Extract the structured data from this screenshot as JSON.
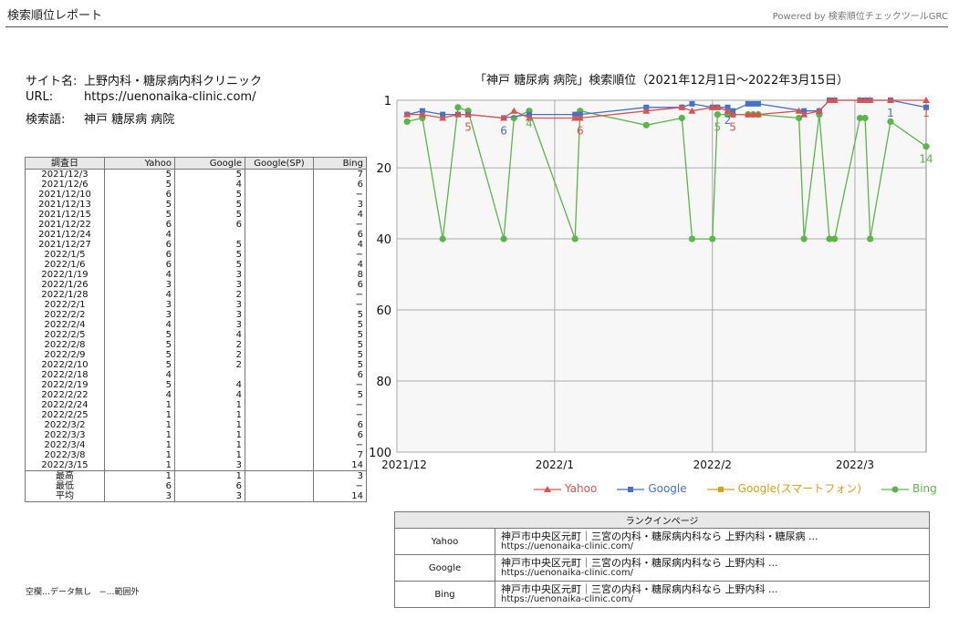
{
  "header": {
    "title": "検索順位レポート",
    "powered": "Powered by 検索順位チェックツールGRC"
  },
  "site": {
    "name_label": "サイト名:",
    "name": "上野内科・糖尿病内科クリニック",
    "url_label": "URL:",
    "url": "https://uenonaika-clinic.com/",
    "keyword_label": "検索語:",
    "keyword": "神戸 糖尿病 病院"
  },
  "table": {
    "headers": [
      "調査日",
      "Yahoo",
      "Google",
      "Google(SP)",
      "Bing"
    ],
    "rows": [
      [
        "2021/12/3",
        "5",
        "5",
        "",
        "7"
      ],
      [
        "2021/12/6",
        "5",
        "4",
        "",
        "6"
      ],
      [
        "2021/12/10",
        "6",
        "5",
        "",
        "−"
      ],
      [
        "2021/12/13",
        "5",
        "5",
        "",
        "3"
      ],
      [
        "2021/12/15",
        "5",
        "5",
        "",
        "4"
      ],
      [
        "2021/12/22",
        "6",
        "6",
        "",
        "−"
      ],
      [
        "2021/12/24",
        "4",
        "",
        "",
        "6"
      ],
      [
        "2021/12/27",
        "6",
        "5",
        "",
        "4"
      ],
      [
        "2022/1/5",
        "6",
        "5",
        "",
        "−"
      ],
      [
        "2022/1/6",
        "6",
        "5",
        "",
        "4"
      ],
      [
        "2022/1/19",
        "4",
        "3",
        "",
        "8"
      ],
      [
        "2022/1/26",
        "3",
        "3",
        "",
        "6"
      ],
      [
        "2022/1/28",
        "4",
        "2",
        "",
        "−"
      ],
      [
        "2022/2/1",
        "3",
        "3",
        "",
        "−"
      ],
      [
        "2022/2/2",
        "3",
        "3",
        "",
        "5"
      ],
      [
        "2022/2/4",
        "4",
        "3",
        "",
        "5"
      ],
      [
        "2022/2/5",
        "5",
        "4",
        "",
        "5"
      ],
      [
        "2022/2/8",
        "5",
        "2",
        "",
        "5"
      ],
      [
        "2022/2/9",
        "5",
        "2",
        "",
        "5"
      ],
      [
        "2022/2/10",
        "5",
        "2",
        "",
        "5"
      ],
      [
        "2022/2/18",
        "4",
        "",
        "",
        "6"
      ],
      [
        "2022/2/19",
        "5",
        "4",
        "",
        "−"
      ],
      [
        "2022/2/22",
        "4",
        "4",
        "",
        "5"
      ],
      [
        "2022/2/24",
        "1",
        "1",
        "",
        "−"
      ],
      [
        "2022/2/25",
        "1",
        "1",
        "",
        "−"
      ],
      [
        "2022/3/2",
        "1",
        "1",
        "",
        "6"
      ],
      [
        "2022/3/3",
        "1",
        "1",
        "",
        "6"
      ],
      [
        "2022/3/4",
        "1",
        "1",
        "",
        "−"
      ],
      [
        "2022/3/8",
        "1",
        "1",
        "",
        "7"
      ],
      [
        "2022/3/15",
        "1",
        "3",
        "",
        "14"
      ]
    ],
    "summary": [
      [
        "最高",
        "1",
        "1",
        "",
        "3"
      ],
      [
        "最低",
        "6",
        "6",
        "",
        "−"
      ],
      [
        "平均",
        "3",
        "3",
        "",
        "14"
      ]
    ]
  },
  "note": "空欄…データ無し　−…範囲外",
  "chart_data": {
    "type": "line",
    "title": "「神戸 糖尿病 病院」検索順位（2021年12月1日～2022年3月15日）",
    "y_reversed": true,
    "ylim": [
      1,
      100
    ],
    "y_ticks": [
      1,
      20,
      40,
      60,
      80,
      100
    ],
    "xlim": [
      "2021-12-01",
      "2022-03-15"
    ],
    "x_ticks": [
      {
        "date": "2021-12-01",
        "label": "2021/12"
      },
      {
        "date": "2022-01-01",
        "label": "2022/1"
      },
      {
        "date": "2022-02-01",
        "label": "2022/2"
      },
      {
        "date": "2022-03-01",
        "label": "2022/3"
      }
    ],
    "grid": true,
    "legend_position": "bottom",
    "series": [
      {
        "name": "Yahoo",
        "color": "#d9534f",
        "marker": "triangle",
        "points": [
          [
            "2021-12-03",
            5
          ],
          [
            "2021-12-06",
            5
          ],
          [
            "2021-12-10",
            6
          ],
          [
            "2021-12-13",
            5
          ],
          [
            "2021-12-15",
            5
          ],
          [
            "2021-12-22",
            6
          ],
          [
            "2021-12-24",
            4
          ],
          [
            "2021-12-27",
            6
          ],
          [
            "2022-01-05",
            6
          ],
          [
            "2022-01-06",
            6
          ],
          [
            "2022-01-19",
            4
          ],
          [
            "2022-01-26",
            3
          ],
          [
            "2022-01-28",
            4
          ],
          [
            "2022-02-01",
            3
          ],
          [
            "2022-02-02",
            3
          ],
          [
            "2022-02-04",
            4
          ],
          [
            "2022-02-05",
            5
          ],
          [
            "2022-02-08",
            5
          ],
          [
            "2022-02-09",
            5
          ],
          [
            "2022-02-10",
            5
          ],
          [
            "2022-02-18",
            4
          ],
          [
            "2022-02-19",
            5
          ],
          [
            "2022-02-22",
            4
          ],
          [
            "2022-02-24",
            1
          ],
          [
            "2022-02-25",
            1
          ],
          [
            "2022-03-02",
            1
          ],
          [
            "2022-03-03",
            1
          ],
          [
            "2022-03-04",
            1
          ],
          [
            "2022-03-08",
            1
          ],
          [
            "2022-03-15",
            1
          ]
        ]
      },
      {
        "name": "Google",
        "color": "#4472c4",
        "marker": "square",
        "points": [
          [
            "2021-12-03",
            5
          ],
          [
            "2021-12-06",
            4
          ],
          [
            "2021-12-10",
            5
          ],
          [
            "2021-12-13",
            5
          ],
          [
            "2021-12-15",
            5
          ],
          [
            "2021-12-22",
            6
          ],
          [
            "2021-12-27",
            5
          ],
          [
            "2022-01-05",
            5
          ],
          [
            "2022-01-06",
            5
          ],
          [
            "2022-01-19",
            3
          ],
          [
            "2022-01-26",
            3
          ],
          [
            "2022-01-28",
            2
          ],
          [
            "2022-02-01",
            3
          ],
          [
            "2022-02-02",
            3
          ],
          [
            "2022-02-04",
            3
          ],
          [
            "2022-02-05",
            4
          ],
          [
            "2022-02-08",
            2
          ],
          [
            "2022-02-09",
            2
          ],
          [
            "2022-02-10",
            2
          ],
          [
            "2022-02-19",
            4
          ],
          [
            "2022-02-22",
            4
          ],
          [
            "2022-02-24",
            1
          ],
          [
            "2022-02-25",
            1
          ],
          [
            "2022-03-02",
            1
          ],
          [
            "2022-03-03",
            1
          ],
          [
            "2022-03-04",
            1
          ],
          [
            "2022-03-08",
            1
          ],
          [
            "2022-03-15",
            3
          ]
        ]
      },
      {
        "name": "Google(スマートフォン)",
        "color": "#d4a017",
        "marker": "square",
        "points": []
      },
      {
        "name": "Bing",
        "color": "#5ab54a",
        "marker": "circle",
        "points": [
          [
            "2021-12-03",
            7
          ],
          [
            "2021-12-06",
            6
          ],
          [
            "2021-12-10",
            40
          ],
          [
            "2021-12-13",
            3
          ],
          [
            "2021-12-15",
            4
          ],
          [
            "2021-12-22",
            40
          ],
          [
            "2021-12-24",
            6
          ],
          [
            "2021-12-27",
            4
          ],
          [
            "2022-01-05",
            40
          ],
          [
            "2022-01-06",
            4
          ],
          [
            "2022-01-19",
            8
          ],
          [
            "2022-01-26",
            6
          ],
          [
            "2022-01-28",
            40
          ],
          [
            "2022-02-01",
            40
          ],
          [
            "2022-02-02",
            5
          ],
          [
            "2022-02-04",
            5
          ],
          [
            "2022-02-05",
            5
          ],
          [
            "2022-02-08",
            5
          ],
          [
            "2022-02-09",
            5
          ],
          [
            "2022-02-10",
            5
          ],
          [
            "2022-02-18",
            6
          ],
          [
            "2022-02-19",
            40
          ],
          [
            "2022-02-22",
            5
          ],
          [
            "2022-02-24",
            40
          ],
          [
            "2022-02-25",
            40
          ],
          [
            "2022-03-02",
            6
          ],
          [
            "2022-03-03",
            6
          ],
          [
            "2022-03-04",
            40
          ],
          [
            "2022-03-08",
            7
          ],
          [
            "2022-03-15",
            14
          ]
        ]
      }
    ],
    "annotations": [
      {
        "text": "6",
        "series": "Google",
        "date": "2021-12-22",
        "value": 6
      },
      {
        "text": "5",
        "series": "Yahoo",
        "date": "2021-12-15",
        "value": 5
      },
      {
        "text": "4",
        "series": "Bing",
        "date": "2021-12-27",
        "value": 4
      },
      {
        "text": "6",
        "series": "Yahoo",
        "date": "2022-01-06",
        "value": 6
      },
      {
        "text": "5",
        "series": "Bing",
        "date": "2022-02-02",
        "value": 5
      },
      {
        "text": "5",
        "series": "Yahoo",
        "date": "2022-02-05",
        "value": 5
      },
      {
        "text": "2",
        "series": "Google",
        "date": "2022-02-04",
        "value": 3
      },
      {
        "text": "1",
        "series": "Google",
        "date": "2022-03-08",
        "value": 1
      },
      {
        "text": "14",
        "series": "Bing",
        "date": "2022-03-15",
        "value": 14
      },
      {
        "text": "1",
        "series": "Yahoo",
        "date": "2022-03-15",
        "value": 1
      }
    ]
  },
  "rank_in_page": {
    "header": "ランクインページ",
    "rows": [
      {
        "engine": "Yahoo",
        "title": "神戸市中央区元町｜三宮の内科・糖尿病内科なら 上野内科・糖尿病 ...",
        "url": "https://uenonaika-clinic.com/"
      },
      {
        "engine": "Google",
        "title": "神戸市中央区元町｜三宮の内科・糖尿病内科なら 上野内科 ...",
        "url": "https://uenonaika-clinic.com/"
      },
      {
        "engine": "Bing",
        "title": "神戸市中央区元町｜三宮の内科・糖尿病内科なら 上野内科 ...",
        "url": "https://uenonaika-clinic.com/"
      }
    ]
  }
}
